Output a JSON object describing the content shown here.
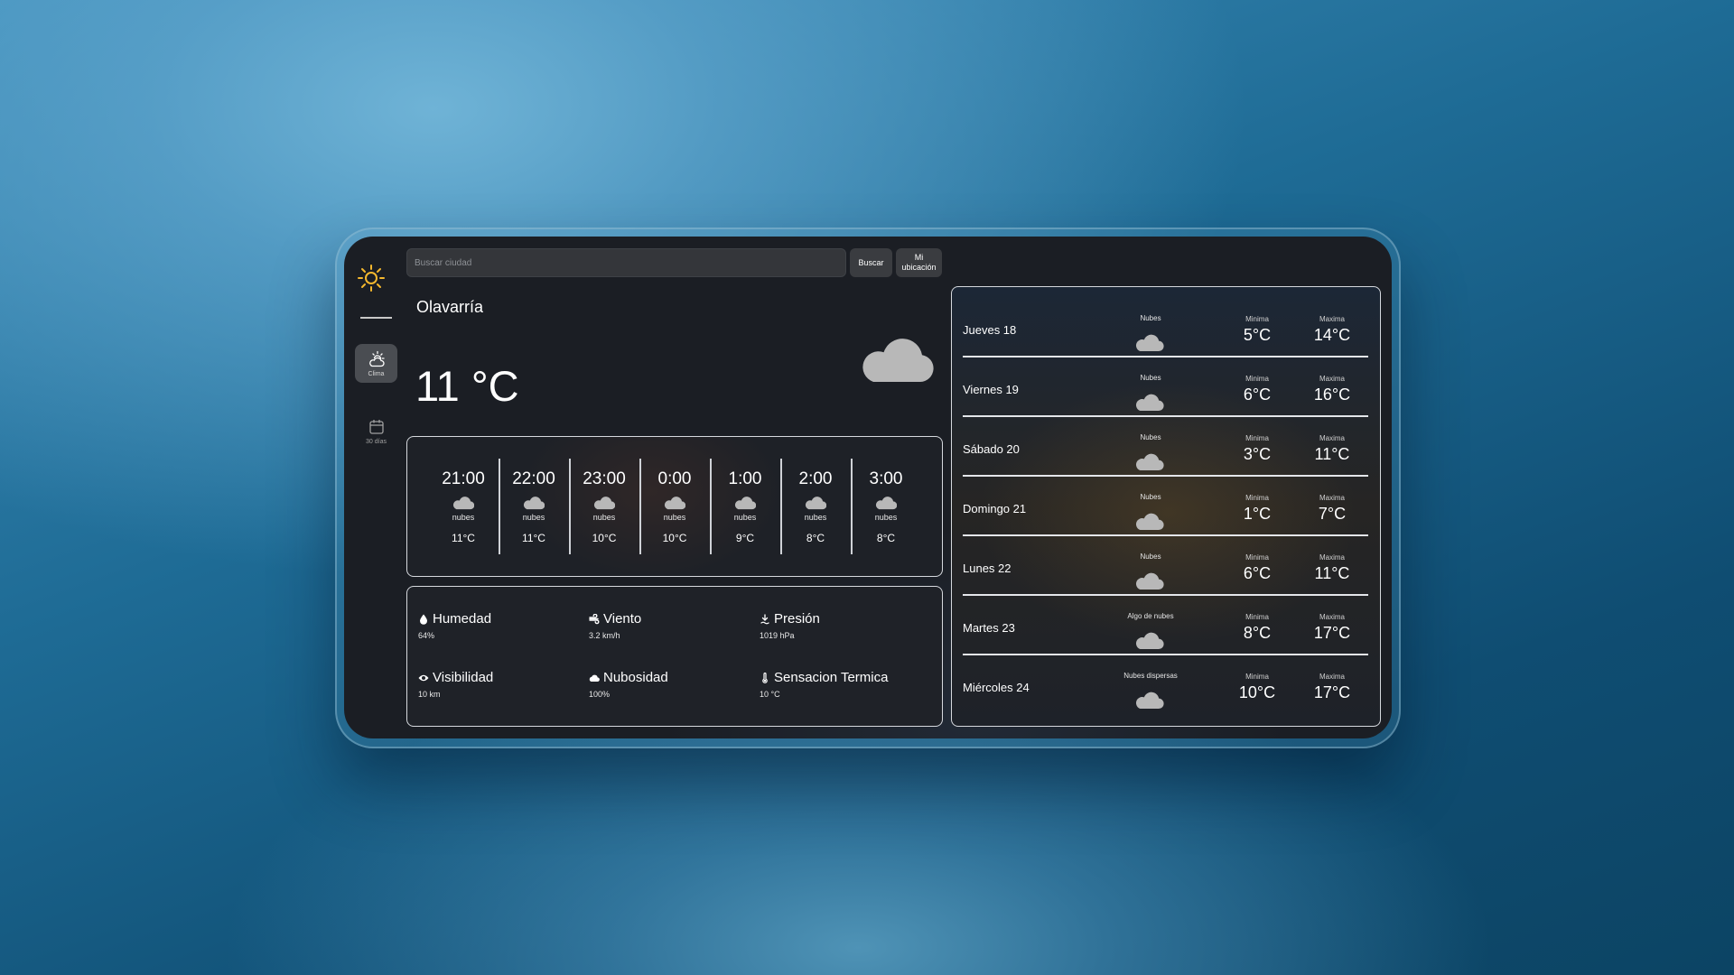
{
  "colors": {
    "accent_sun": "#f5b82e",
    "icon_cloud": "#b8b8b8",
    "panel_border": "#d6d9de"
  },
  "sidebar": {
    "logo_icon": "sun-icon",
    "items": [
      {
        "label": "Clima",
        "icon": "cloud-sun-icon",
        "active": true
      },
      {
        "label": "30 días",
        "icon": "calendar-icon",
        "active": false
      }
    ]
  },
  "search": {
    "placeholder": "Buscar ciudad",
    "value": ""
  },
  "buttons": {
    "search": "Buscar",
    "location_line1": "Mi",
    "location_line2": "ubicación"
  },
  "current": {
    "city": "Olavarría",
    "temperature": "11 °C",
    "icon": "cloud-icon"
  },
  "hourly": [
    {
      "time": "21:00",
      "desc": "nubes",
      "temp": "11°C"
    },
    {
      "time": "22:00",
      "desc": "nubes",
      "temp": "11°C"
    },
    {
      "time": "23:00",
      "desc": "nubes",
      "temp": "10°C"
    },
    {
      "time": "0:00",
      "desc": "nubes",
      "temp": "10°C"
    },
    {
      "time": "1:00",
      "desc": "nubes",
      "temp": "9°C"
    },
    {
      "time": "2:00",
      "desc": "nubes",
      "temp": "8°C"
    },
    {
      "time": "3:00",
      "desc": "nubes",
      "temp": "8°C"
    }
  ],
  "details": [
    {
      "label": "Humedad",
      "value": "64%",
      "icon": "droplet-icon"
    },
    {
      "label": "Viento",
      "value": "3.2 km/h",
      "icon": "wind-icon"
    },
    {
      "label": "Presión",
      "value": "1019 hPa",
      "icon": "pressure-icon"
    },
    {
      "label": "Visibilidad",
      "value": "10 km",
      "icon": "eye-icon"
    },
    {
      "label": "Nubosidad",
      "value": "100%",
      "icon": "cloud-icon"
    },
    {
      "label": "Sensacion Termica",
      "value": "10 °C",
      "icon": "thermometer-icon"
    }
  ],
  "forecast": {
    "min_label": "Minima",
    "max_label": "Maxima",
    "days": [
      {
        "day": "Jueves 18",
        "desc": "Nubes",
        "min": "5°C",
        "max": "14°C"
      },
      {
        "day": "Viernes 19",
        "desc": "Nubes",
        "min": "6°C",
        "max": "16°C"
      },
      {
        "day": "Sábado 20",
        "desc": "Nubes",
        "min": "3°C",
        "max": "11°C"
      },
      {
        "day": "Domingo 21",
        "desc": "Nubes",
        "min": "1°C",
        "max": "7°C"
      },
      {
        "day": "Lunes 22",
        "desc": "Nubes",
        "min": "6°C",
        "max": "11°C"
      },
      {
        "day": "Martes 23",
        "desc": "Algo de nubes",
        "min": "8°C",
        "max": "17°C"
      },
      {
        "day": "Miércoles 24",
        "desc": "Nubes dispersas",
        "min": "10°C",
        "max": "17°C"
      }
    ]
  }
}
